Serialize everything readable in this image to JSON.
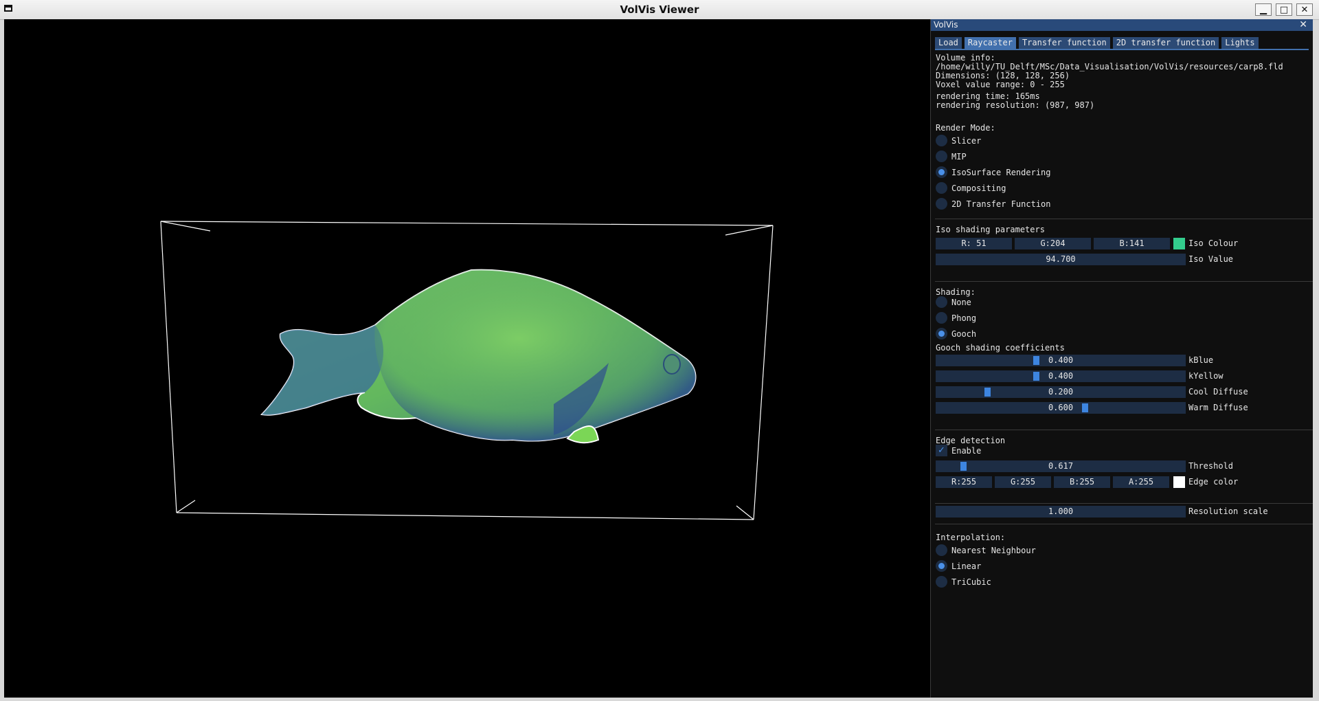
{
  "window": {
    "title": "VolVis Viewer"
  },
  "panel": {
    "title": "VolVis",
    "tabs": [
      {
        "label": "Load"
      },
      {
        "label": "Raycaster"
      },
      {
        "label": "Transfer function"
      },
      {
        "label": "2D transfer function"
      },
      {
        "label": "Lights"
      }
    ],
    "active_tab": "Raycaster",
    "info": {
      "heading": "Volume info:",
      "path": "/home/willy/TU_Delft/MSc/Data_Visualisation/VolVis/resources/carp8.fld",
      "dimensions": "Dimensions: (128, 128, 256)",
      "voxel_range": "Voxel value range: 0 - 255",
      "render_time": "rendering time: 165ms",
      "render_res": "rendering resolution: (987, 987)"
    },
    "render_mode": {
      "heading": "Render Mode:",
      "options": [
        "Slicer",
        "MIP",
        "IsoSurface Rendering",
        "Compositing",
        "2D Transfer Function"
      ],
      "selected": "IsoSurface Rendering"
    },
    "iso": {
      "heading": "Iso shading parameters",
      "r": "R: 51",
      "g": "G:204",
      "b": "B:141",
      "colour_label": "Iso Colour",
      "colour_hex": "#33cc8d",
      "value": "94.700",
      "value_label": "Iso Value"
    },
    "shading": {
      "heading": "Shading:",
      "options": [
        "None",
        "Phong",
        "Gooch"
      ],
      "selected": "Gooch"
    },
    "gooch": {
      "heading": "Gooch shading coefficients",
      "sliders": [
        {
          "label": "kBlue",
          "value": "0.400",
          "fraction": 0.4
        },
        {
          "label": "kYellow",
          "value": "0.400",
          "fraction": 0.4
        },
        {
          "label": "Cool Diffuse",
          "value": "0.200",
          "fraction": 0.2
        },
        {
          "label": "Warm Diffuse",
          "value": "0.600",
          "fraction": 0.6
        }
      ]
    },
    "edge": {
      "heading": "Edge detection",
      "enable_label": "Enable",
      "enabled": true,
      "threshold": "0.617",
      "threshold_fraction": 0.1,
      "threshold_label": "Threshold",
      "r": "R:255",
      "g": "G:255",
      "b": "B:255",
      "a": "A:255",
      "color_label": "Edge color",
      "color_hex": "#ffffff"
    },
    "resolution": {
      "value": "1.000",
      "label": "Resolution scale"
    },
    "interpolation": {
      "heading": "Interpolation:",
      "options": [
        "Nearest Neighbour",
        "Linear",
        "TriCubic"
      ],
      "selected": "Linear"
    }
  }
}
